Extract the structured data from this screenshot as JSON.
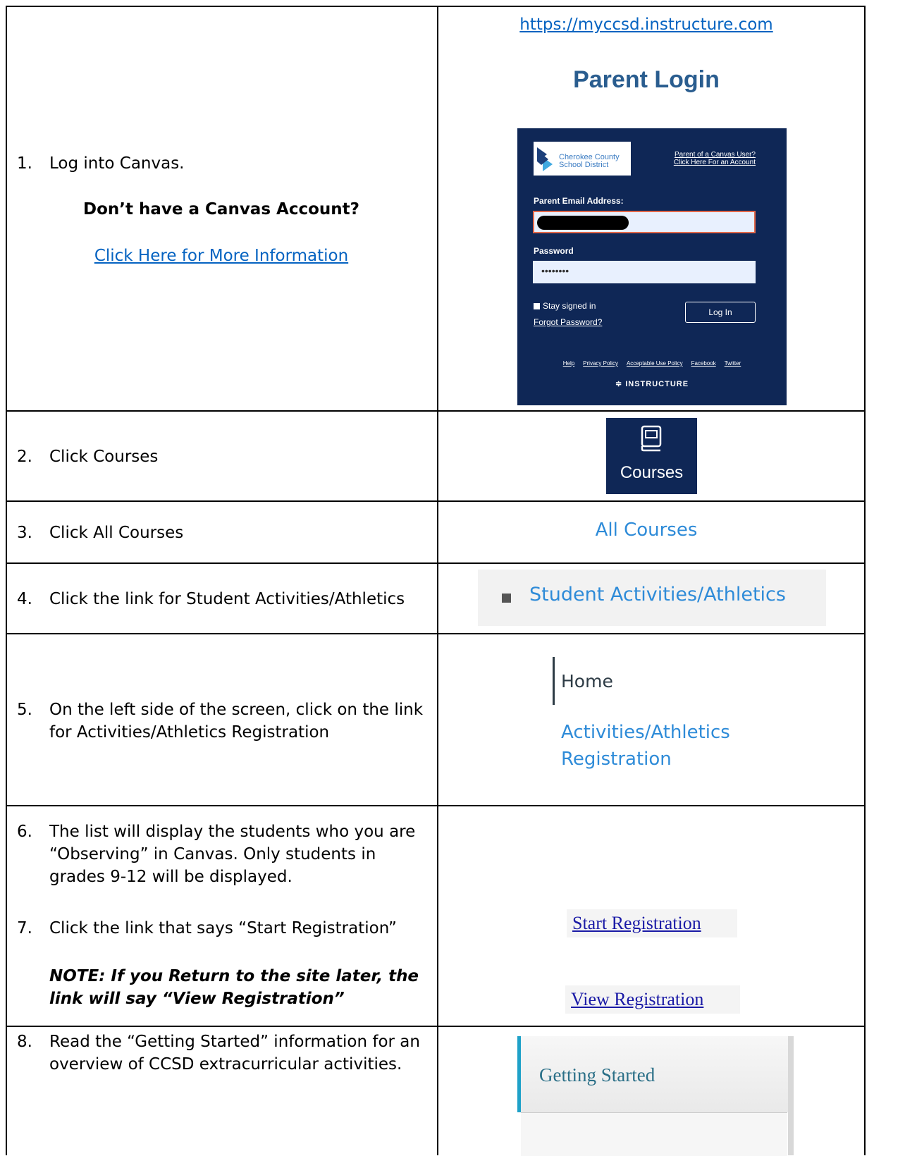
{
  "url": "https://myccsd.instructure.com",
  "parent_login_heading": "Parent Login",
  "steps": {
    "s1": {
      "num": "1.",
      "text": "Log into Canvas."
    },
    "s1_account_q": "Don’t have a Canvas Account?",
    "s1_link": "Click Here for More Information",
    "s2": {
      "num": "2.",
      "text": "Click Courses"
    },
    "s3": {
      "num": "3.",
      "text": "Click All Courses"
    },
    "s4": {
      "num": "4.",
      "text": "Click the link for Student Activities/Athletics"
    },
    "s5": {
      "num": "5.",
      "text": "On the left side of the screen, click on the link for Activities/Athletics Registration"
    },
    "s6": {
      "num": "6.",
      "text": "The list will display the students who you are “Observing” in Canvas. Only students in grades 9-12 will be displayed."
    },
    "s7": {
      "num": "7.",
      "text": "Click the link that says “Start Registration”"
    },
    "s7_note": "NOTE: If you Return to the site later, the link will say “View Registration”",
    "s8": {
      "num": "8.",
      "text": "Read the “Getting Started” information for an overview of CCSD extracurricular activities."
    }
  },
  "login": {
    "logo_line1": "Cherokee County",
    "logo_line2": "School District",
    "parent_link_line1": "Parent of a Canvas User?",
    "parent_link_line2": "Click Here For an Account",
    "email_label": "Parent Email Address:",
    "password_label": "Password",
    "password_value": "••••••••",
    "stay_signed_in": "Stay signed in",
    "forgot_password": "Forgot Password?",
    "login_button": "Log In",
    "footer_links": [
      "Help",
      "Privacy Policy",
      "Acceptable Use Policy",
      "Facebook",
      "Twitter"
    ],
    "brand": "≑ INSTRUCTURE"
  },
  "courses_label": "Courses",
  "all_courses": "All Courses",
  "student_activities": "Student Activities/Athletics",
  "home": "Home",
  "activities_registration_line1": "Activities/Athletics",
  "activities_registration_line2": "Registration",
  "start_registration": "Start Registration",
  "view_registration": "View Registration",
  "getting_started": "Getting Started",
  "colors": {
    "canvas_navy": "#0f2756",
    "link_blue": "#2e8bd8",
    "doc_link": "#0563c1",
    "accent_teal": "#1ea1c8"
  }
}
